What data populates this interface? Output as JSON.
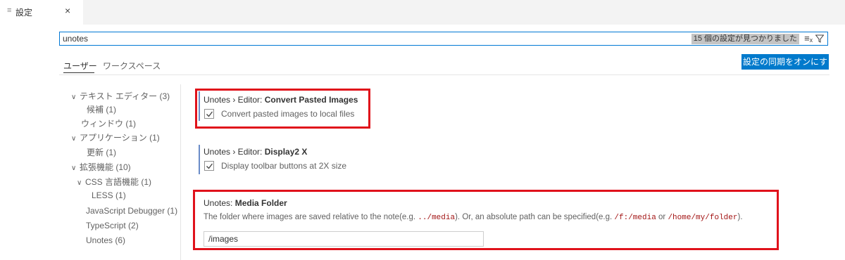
{
  "tab": {
    "icon": "list-icon",
    "label": "設定",
    "close": "×"
  },
  "search": {
    "value": "unotes",
    "count": "15 個の設定が見つかりました"
  },
  "scopes": {
    "user": "ユーザー",
    "workspace": "ワークスペース"
  },
  "sync_button": "設定の同期をオンにする",
  "toc": [
    {
      "chevron": "∨",
      "label": "テキスト エディター (3)"
    },
    {
      "label": "候補 (1)"
    },
    {
      "label": "ウィンドウ (1)"
    },
    {
      "chevron": "∨",
      "label": "アプリケーション (1)"
    },
    {
      "label": "更新 (1)"
    },
    {
      "chevron": "∨",
      "label": "拡張機能 (10)"
    },
    {
      "chevron": "∨",
      "label": "CSS 言語機能 (1)"
    },
    {
      "label": "LESS (1)"
    },
    {
      "label": "JavaScript Debugger (1)"
    },
    {
      "label": "TypeScript (2)"
    },
    {
      "label": "Unotes (6)"
    }
  ],
  "settings": {
    "convert": {
      "prefix": "Unotes › Editor: ",
      "name": "Convert Pasted Images",
      "checked": true,
      "desc": "Convert pasted images to local files"
    },
    "display": {
      "prefix": "Unotes › Editor: ",
      "name": "Display2 X",
      "checked": true,
      "desc": "Display toolbar buttons at 2X size"
    },
    "media": {
      "prefix": "Unotes: ",
      "name": "Media Folder",
      "desc_1": "The folder where images are saved relative to the note(e.g. ",
      "code_1": "../media",
      "desc_2": "). Or, an absolute path can be specified(e.g. ",
      "code_2": "/f:/media",
      "desc_3": " or ",
      "code_3": "/home/my/folder",
      "desc_4": ").",
      "value": "/images"
    }
  },
  "colors": {
    "accent": "#007acc",
    "highlight": "#e0121b",
    "code": "#a31515"
  }
}
